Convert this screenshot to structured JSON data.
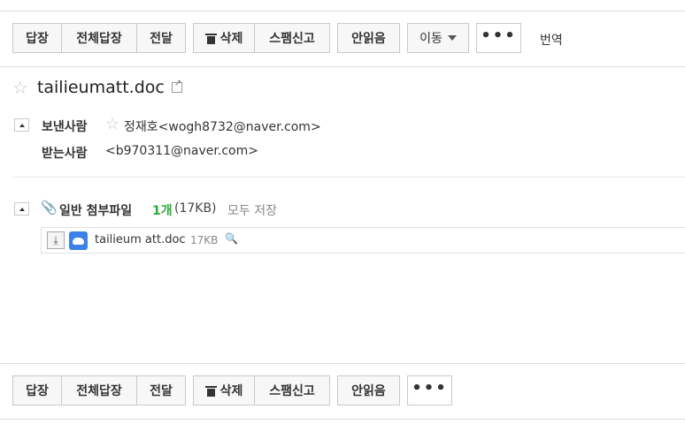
{
  "toolbar": {
    "reply": "답장",
    "reply_all": "전체답장",
    "forward": "전달",
    "delete": "삭제",
    "spam": "스팸신고",
    "unread": "안읽음",
    "move": "이동",
    "more": "•••",
    "translate": "번역"
  },
  "mail": {
    "subject": "tailieumatt.doc",
    "from_label": "보낸사람",
    "from_value": "정재호<wogh8732@naver.com>",
    "to_label": "받는사람",
    "to_value": "<b970311@naver.com>"
  },
  "attachments": {
    "label": "일반 첨부파일",
    "count": "1개",
    "total_size": "(17KB)",
    "save_all": "모두 저장",
    "files": [
      {
        "name": "tailieum att.doc",
        "size": "17KB"
      }
    ]
  },
  "colors": {
    "accent_green": "#2dac3c",
    "cloud_blue": "#3b82e8"
  },
  "icons": [
    "star-icon",
    "trash-icon",
    "external-link-icon",
    "paperclip-icon",
    "download-icon",
    "cloud-icon",
    "magnifier-icon",
    "caret-down-icon"
  ]
}
